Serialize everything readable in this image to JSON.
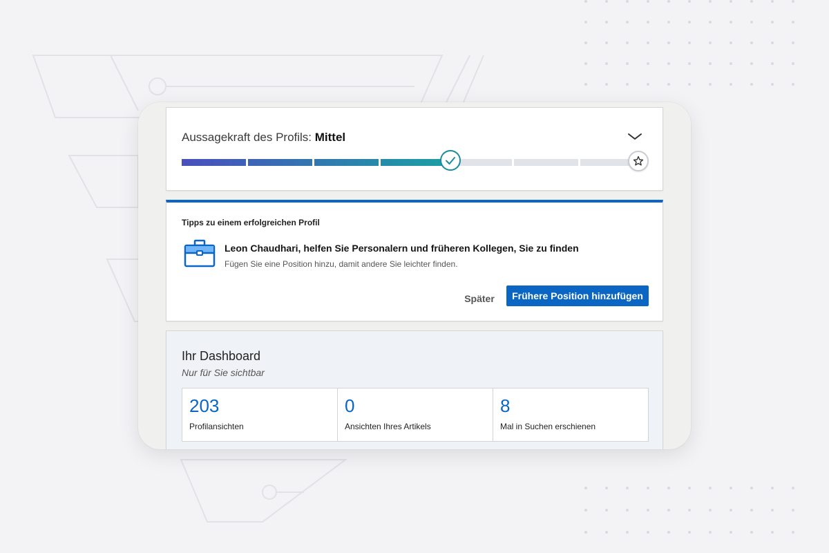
{
  "strength": {
    "label": "Aussagekraft des Profils:",
    "level": "Mittel",
    "progress_fraction": 0.58,
    "steps_total": 7,
    "steps_completed": 4
  },
  "tips": {
    "heading": "Tipps zu einem erfolgreichen Profil",
    "headline": "Leon Chaudhari, helfen Sie Personalern und früheren Kollegen, Sie zu finden",
    "subtext": "Fügen Sie eine Position hinzu, damit andere Sie leichter finden.",
    "later_label": "Später",
    "primary_label": "Frühere Position hinzufügen"
  },
  "dashboard": {
    "title": "Ihr Dashboard",
    "subtitle": "Nur für Sie sichtbar",
    "stats": [
      {
        "value": "203",
        "label": "Profilansichten"
      },
      {
        "value": "0",
        "label": "Ansichten Ihres Artikels"
      },
      {
        "value": "8",
        "label": "Mal in Suchen erschienen"
      }
    ]
  },
  "colors": {
    "accent": "#0a66c2",
    "progress_start": "#4a4fbd",
    "progress_end": "#1aa0a3",
    "track": "#e1e3e8"
  },
  "icons": {
    "chevron": "chevron-down-icon",
    "check": "checkmark-icon",
    "star": "star-icon",
    "briefcase": "briefcase-icon"
  }
}
